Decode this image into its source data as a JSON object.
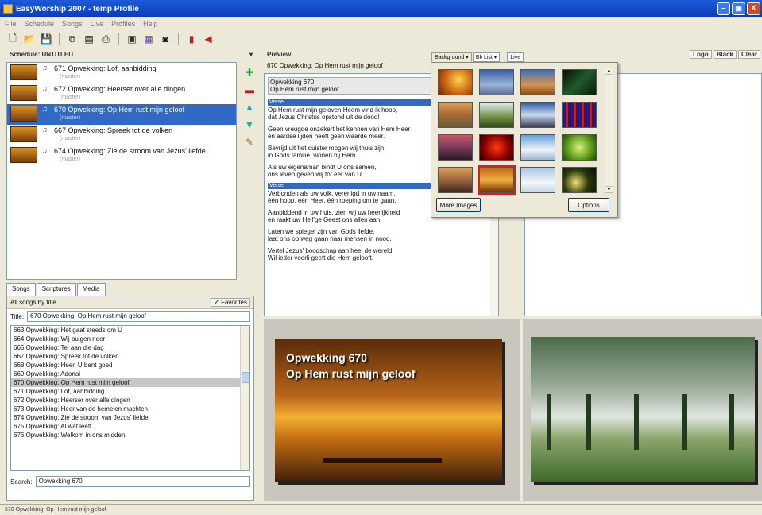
{
  "window": {
    "title": "EasyWorship 2007 - temp Profile",
    "min": "–",
    "max": "▣",
    "close": "X"
  },
  "menu": [
    "File",
    "Schedule",
    "Songs",
    "Live",
    "Profiles",
    "Help"
  ],
  "schedule": {
    "header": "Schedule: UNTITLED",
    "items": [
      {
        "label": "671 Opwekking: Lof, aanbidding",
        "sub": "(master)"
      },
      {
        "label": "672 Opwekking: Heerser over alle dingen",
        "sub": "(master)"
      },
      {
        "label": "670 Opwekking: Op Hem rust mijn geloof",
        "sub": "(master)"
      },
      {
        "label": "667 Opwekking: Spreek tot de volken",
        "sub": "(master)"
      },
      {
        "label": "674 Opwekking: Zie de stroom van Jezus' liefde",
        "sub": "(master)"
      }
    ]
  },
  "tabs": [
    "Songs",
    "Scriptures",
    "Media"
  ],
  "songs": {
    "subheader": "All songs by title",
    "favorites": "Favorites",
    "title_label": "Title:",
    "title_value": "670 Opwekking: Op Hem rust mijn geloof",
    "list": [
      "663 Opwekking: Het gaat steeds om U",
      "664 Opwekking: Wij buigen neer",
      "665 Opwekking: Tel aan die dag",
      "667 Opwekking: Spreek tot de volken",
      "668 Opwekking: Heer, U bent goed",
      "669 Opwekking: Adonai",
      "670 Opwekking: Op Hem rust mijn geloof",
      "671 Opwekking: Lof, aanbidding",
      "672 Opwekking: Heerser over alle dingen",
      "673 Opwekking: Heer van de hemelen machten",
      "674 Opwekking: Zie de stroom van Jezus' liefde",
      "675 Opwekking: Al wat leeft",
      "676 Opwekking: Welkom in ons midden"
    ],
    "search_label": "Search:",
    "search_value": "Opwekking 670"
  },
  "preview": {
    "header": "Preview",
    "song_line": "670 Opwekking: Op Hem rust mijn geloof",
    "title_box": [
      "Opwekking 670",
      "Op Hem rust mijn geloof"
    ],
    "verse_label": "Verse",
    "verses": [
      [
        "Op Hem rust mijn geloven Heem vind ik hoop,",
        "dat Jezus Christus opstond uit de dood!"
      ],
      [
        "Geen vreugde onzekert het kennen van Hem Heer",
        "en aardse lijden heeft geen waarde meer."
      ],
      [
        "Bevrijd uit het duister mogen wij thuis zijn",
        "in Gods familie, wonen bij Hem."
      ],
      [
        "Als uw eigenaman bindt U ons samen,",
        "ons leven geven wij tot eer van U."
      ]
    ],
    "verse_label2": "Verse",
    "verses2": [
      [
        "Verbonden als uw volk, verenigd in uw naam,",
        "één hoop, één Heer, één roeping om te gaan."
      ],
      [
        "Aanbiddend in uw huis, zien wij uw heerlijkheid",
        "en raakt uw Heil'ge Geest ons allen aan."
      ],
      [
        "Laten we spiegel zijn van Gods liefde,",
        "laat ons op weg gaan naar mensen in nood."
      ],
      [
        "Vertel Jezus' boodschap aan heel de wereld,",
        "Wil ieder voorli geeft die Hem gelooft."
      ]
    ]
  },
  "bg_popup": {
    "tab_background": "Background",
    "tab_list": "Bk List",
    "tab_live": "Live",
    "more_images": "More Images",
    "options": "Options"
  },
  "live": {
    "buttons": [
      "Logo",
      "Black",
      "Clear"
    ]
  },
  "output": {
    "line1": "Opwekking 670",
    "line2": "Op Hem rust mijn geloof"
  },
  "status": "670 Opwekking: Op Hem rust mijn geloof",
  "colors": {
    "selection": "#316ac5",
    "titlebar": "#0a3bb8"
  }
}
